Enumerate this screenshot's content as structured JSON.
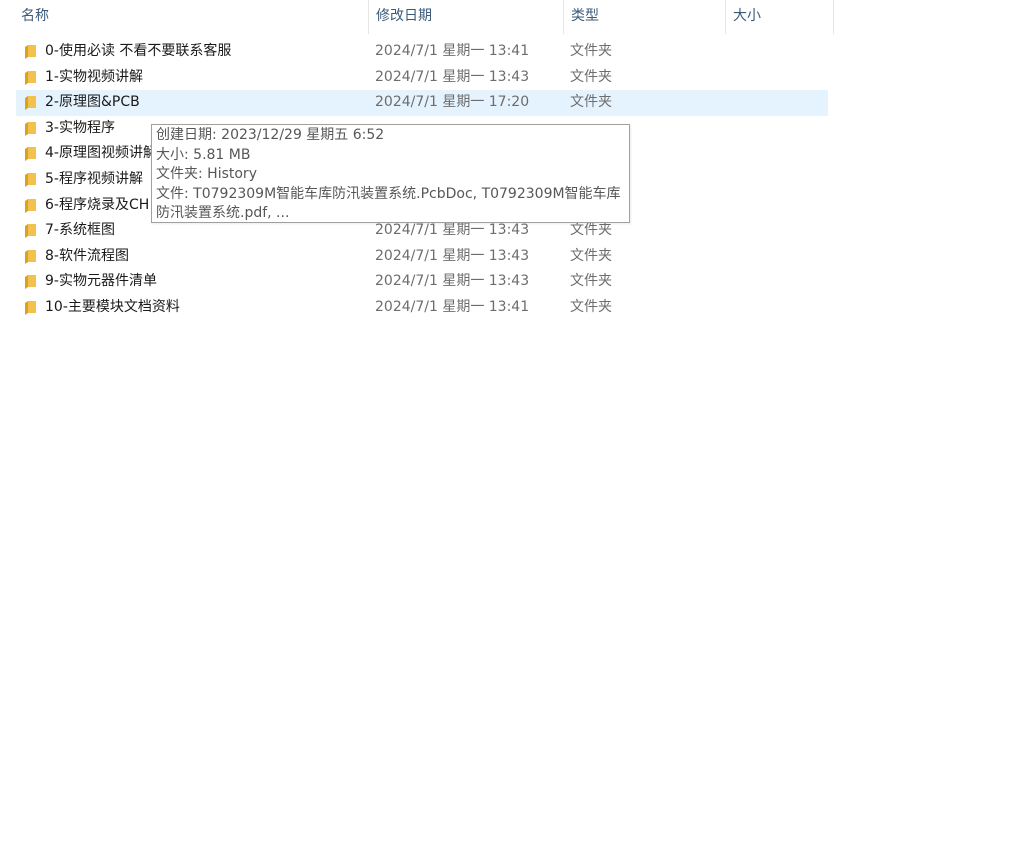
{
  "columns": {
    "name": "名称",
    "date": "修改日期",
    "type": "类型",
    "size": "大小",
    "sort_indicator": "^"
  },
  "rows": [
    {
      "name": "0-使用必读  不看不要联系客服",
      "date": "2024/7/1 星期一 13:41",
      "type": "文件夹"
    },
    {
      "name": "1-实物视频讲解",
      "date": "2024/7/1 星期一 13:43",
      "type": "文件夹"
    },
    {
      "name": "2-原理图&PCB",
      "date": "2024/7/1 星期一 17:20",
      "type": "文件夹",
      "selected": true
    },
    {
      "name": "3-实物程序",
      "date": "",
      "type": ""
    },
    {
      "name": "4-原理图视频讲解",
      "date": "",
      "type": ""
    },
    {
      "name": "5-程序视频讲解",
      "date": "",
      "type": ""
    },
    {
      "name": "6-程序烧录及CH",
      "date": "",
      "type": ""
    },
    {
      "name": "7-系统框图",
      "date": "2024/7/1 星期一 13:43",
      "type": "文件夹"
    },
    {
      "name": "8-软件流程图",
      "date": "2024/7/1 星期一 13:43",
      "type": "文件夹"
    },
    {
      "name": "9-实物元器件清单",
      "date": "2024/7/1 星期一 13:43",
      "type": "文件夹"
    },
    {
      "name": "10-主要模块文档资料",
      "date": "2024/7/1 星期一 13:41",
      "type": "文件夹"
    }
  ],
  "tooltip": {
    "created": "创建日期: 2023/12/29 星期五 6:52",
    "size": "大小: 5.81 MB",
    "folder": "文件夹: History",
    "files_line1": "文件: T0792309M智能车库防汛装置系统.PcbDoc, T0792309M智能车库",
    "files_line2": "防汛装置系统.pdf, ..."
  },
  "colors": {
    "folder": "#f2c14e",
    "selected_row": "#e5f3ff",
    "header_text": "#3b5a7a"
  },
  "icons": {
    "folder": "folder-icon"
  }
}
